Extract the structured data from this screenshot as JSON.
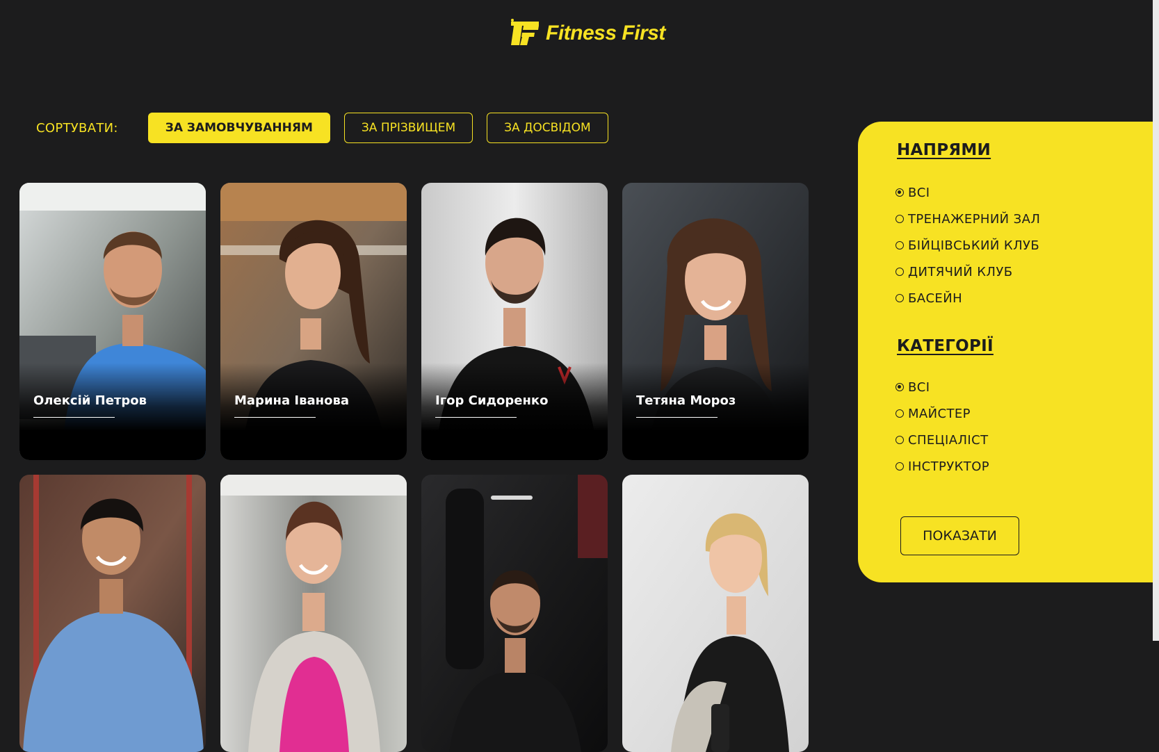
{
  "brand": {
    "name": "Fitness First",
    "accent": "#f7e223",
    "background": "#1c1c1d"
  },
  "sort": {
    "label": "СОРТУВАТИ:",
    "options": [
      {
        "label": "ЗА ЗАМОВЧУВАННЯМ",
        "active": true
      },
      {
        "label": "ЗА ПРІЗВИЩЕМ",
        "active": false
      },
      {
        "label": "ЗА ДОСВІДОМ",
        "active": false
      }
    ]
  },
  "trainers": [
    {
      "name": "Олексій Петров"
    },
    {
      "name": "Марина Іванова"
    },
    {
      "name": "Ігор Сидоренко"
    },
    {
      "name": "Тетяна Мороз"
    },
    {
      "name": ""
    },
    {
      "name": ""
    },
    {
      "name": ""
    },
    {
      "name": ""
    }
  ],
  "filters": {
    "directions": {
      "title": "НАПРЯМИ",
      "options": [
        "ВСІ",
        "ТРЕНАЖЕРНИЙ ЗАЛ",
        "БІЙЦІВСЬКИЙ КЛУБ",
        "ДИТЯЧИЙ КЛУБ",
        "БАСЕЙН"
      ],
      "selected": "ВСІ"
    },
    "categories": {
      "title": "КАТЕГОРІЇ",
      "options": [
        "ВСІ",
        "МАЙСТЕР",
        "СПЕЦІАЛІСТ",
        "ІНСТРУКТОР"
      ],
      "selected": "ВСІ"
    },
    "show_label": "ПОКАЗАТИ"
  }
}
